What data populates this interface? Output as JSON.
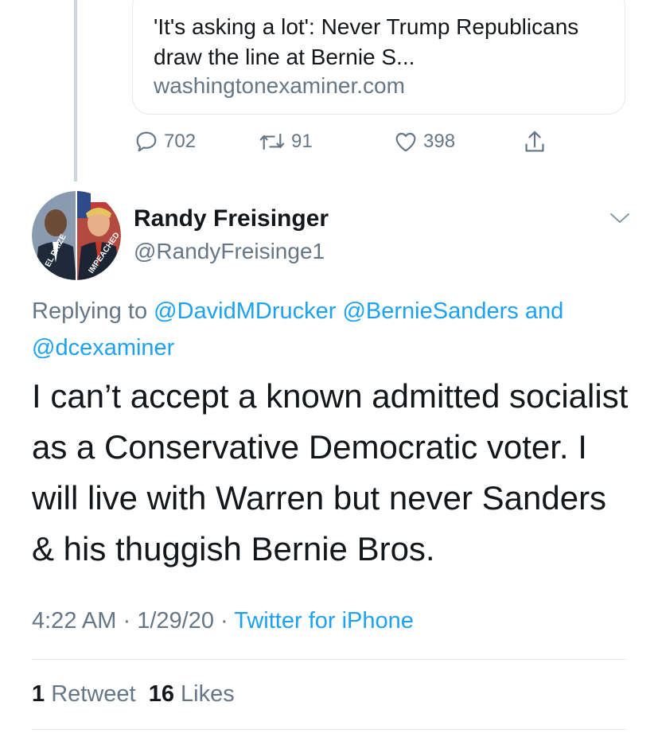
{
  "link_card": {
    "title": "'It's asking a lot': Never Trump Republicans draw the line at Bernie S...",
    "domain": "washingtonexaminer.com"
  },
  "prev_actions": {
    "replies": "702",
    "retweets": "91",
    "likes": "398",
    "icons": [
      "reply-icon",
      "retweet-icon",
      "heart-icon",
      "share-icon"
    ]
  },
  "tweet": {
    "display_name": "Randy Freisinger",
    "handle": "@RandyFreisinge1",
    "avatar_labels": {
      "left": "EL PRIZE",
      "right": "IMPEACHED"
    },
    "replying_prefix": "Replying to",
    "replying_mentions": [
      "@DavidMDrucker",
      "@BernieSanders"
    ],
    "replying_and": "and",
    "replying_last": "@dcexaminer",
    "text": "I can’t accept a known admitted socialist as a Conservative Democratic voter. I will live with Warren but never Sanders & his thuggish Bernie Bros.",
    "time": "4:22 AM",
    "date": "1/29/20",
    "separator": "·",
    "source": "Twitter for iPhone",
    "retweet_count": "1",
    "retweet_label": "Retweet",
    "like_count": "16",
    "like_label": "Likes"
  },
  "colors": {
    "accent": "#1da1f2",
    "secondary_text": "#657786",
    "primary_text": "#14171a",
    "border": "#e1e8ed"
  }
}
